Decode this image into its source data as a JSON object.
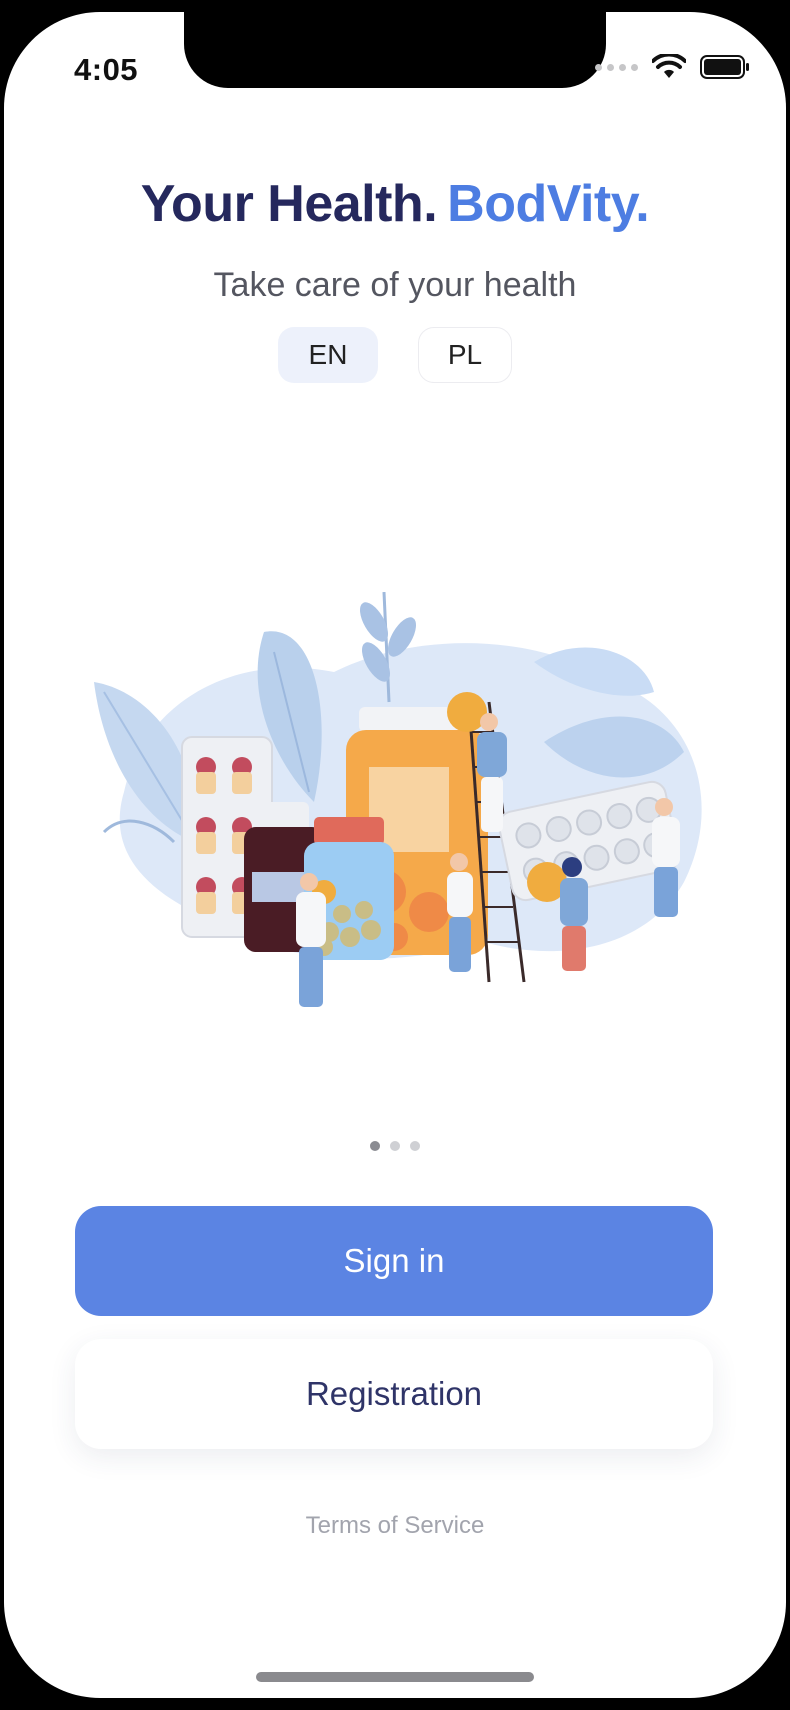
{
  "status": {
    "time": "4:05"
  },
  "header": {
    "title_part1": "Your Health.",
    "title_part2": "BodVity.",
    "subtitle": "Take care of your health"
  },
  "languages": {
    "options": [
      "EN",
      "PL"
    ],
    "selected": "EN"
  },
  "carousel": {
    "page": 1,
    "total": 3
  },
  "buttons": {
    "signin_label": "Sign in",
    "register_label": "Registration"
  },
  "footer": {
    "terms": "Terms of Service"
  },
  "colors": {
    "title_dark": "#25285d",
    "title_accent": "#4d7de2",
    "primary_button": "#5b84e3",
    "register_text": "#2f3468"
  },
  "icons": [
    "wifi-icon",
    "battery-icon",
    "signal-icon"
  ]
}
